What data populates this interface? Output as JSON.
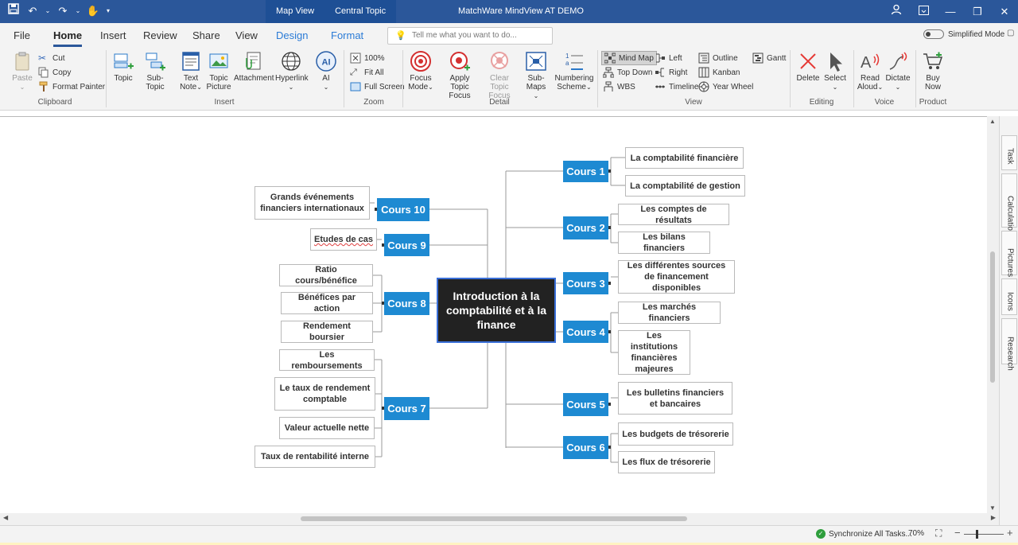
{
  "titlebar": {
    "app_title": "MatchWare MindView AT DEMO",
    "context_tabs": [
      "Map View",
      "Central Topic"
    ],
    "colors": {
      "bar": "#2b579a",
      "context": "#1e4f95"
    }
  },
  "tabs": {
    "items": [
      "File",
      "Home",
      "Insert",
      "Review",
      "Share",
      "View",
      "Design",
      "Format"
    ],
    "active": "Home",
    "tell_me_placeholder": "Tell me what you want to do...",
    "simplified_mode_label": "Simplified Mode"
  },
  "ribbon": {
    "clipboard": {
      "label": "Clipboard",
      "paste": "Paste",
      "cut": "Cut",
      "copy": "Copy",
      "format_painter": "Format Painter"
    },
    "insert": {
      "label": "Insert",
      "topic": "Topic",
      "subtopic": "Sub-Topic",
      "text_note_1": "Text",
      "text_note_2": "Note",
      "topic_picture_1": "Topic",
      "topic_picture_2": "Picture",
      "attachment": "Attachment",
      "hyperlink": "Hyperlink",
      "ai": "AI"
    },
    "zoom": {
      "label": "Zoom",
      "zoom100": "100%",
      "fit_all": "Fit All",
      "full_screen": "Full Screen"
    },
    "detail": {
      "label": "Detail",
      "focus_mode_1": "Focus",
      "focus_mode_2": "Mode",
      "apply_focus_1": "Apply",
      "apply_focus_2": "Topic Focus",
      "clear_focus_1": "Clear Topic",
      "clear_focus_2": "Focus",
      "submaps": "Sub-Maps",
      "numbering_1": "Numbering",
      "numbering_2": "Scheme"
    },
    "view": {
      "label": "View",
      "mind_map": "Mind Map",
      "top_down": "Top Down",
      "wbs": "WBS",
      "left": "Left",
      "right": "Right",
      "timeline": "Timeline",
      "outline": "Outline",
      "kanban": "Kanban",
      "year_wheel": "Year Wheel",
      "gantt": "Gantt"
    },
    "editing": {
      "label": "Editing",
      "delete": "Delete",
      "select": "Select"
    },
    "voice": {
      "label": "Voice",
      "read_aloud_1": "Read",
      "read_aloud_2": "Aloud",
      "dictate": "Dictate"
    },
    "product": {
      "label": "Product",
      "buy_now_1": "Buy",
      "buy_now_2": "Now"
    }
  },
  "map": {
    "central": "Introduction à la comptabilité et à la finance",
    "courses": [
      {
        "id": "c1",
        "label": "Cours 1",
        "subtopics": [
          "La comptabilité financière",
          "La comptabilité de gestion"
        ]
      },
      {
        "id": "c2",
        "label": "Cours 2",
        "subtopics": [
          "Les comptes de résultats",
          "Les bilans financiers"
        ]
      },
      {
        "id": "c3",
        "label": "Cours 3",
        "subtopics": [
          "Les différentes sources de financement disponibles"
        ]
      },
      {
        "id": "c4",
        "label": "Cours 4",
        "subtopics": [
          "Les marchés financiers",
          "Les institutions financières majeures"
        ]
      },
      {
        "id": "c5",
        "label": "Cours 5",
        "subtopics": [
          "Les bulletins financiers et bancaires"
        ]
      },
      {
        "id": "c6",
        "label": "Cours 6",
        "subtopics": [
          "Les budgets de trésorerie",
          "Les flux de trésorerie"
        ]
      },
      {
        "id": "c7",
        "label": "Cours 7",
        "subtopics": [
          "Les remboursements",
          "Le taux de rendement comptable",
          "Valeur actuelle nette",
          "Taux de rentabilité interne"
        ]
      },
      {
        "id": "c8",
        "label": "Cours 8",
        "subtopics": [
          "Ratio cours/bénéfice",
          "Bénéfices par action",
          "Rendement boursier"
        ]
      },
      {
        "id": "c9",
        "label": "Cours 9",
        "subtopics": [
          "Etudes de cas"
        ]
      },
      {
        "id": "c10",
        "label": "Cours 10",
        "subtopics": [
          "Grands événements financiers internationaux"
        ]
      }
    ],
    "colors": {
      "course": "#1e8ad2",
      "central": "#222222",
      "central_border": "#3a6fd8",
      "line": "#9a9a9a"
    }
  },
  "side_panel": {
    "tabs": [
      "Task",
      "Calculation",
      "Pictures",
      "Icons",
      "Research"
    ]
  },
  "status": {
    "sync": "Synchronize All Tasks...",
    "zoom": "70%"
  }
}
